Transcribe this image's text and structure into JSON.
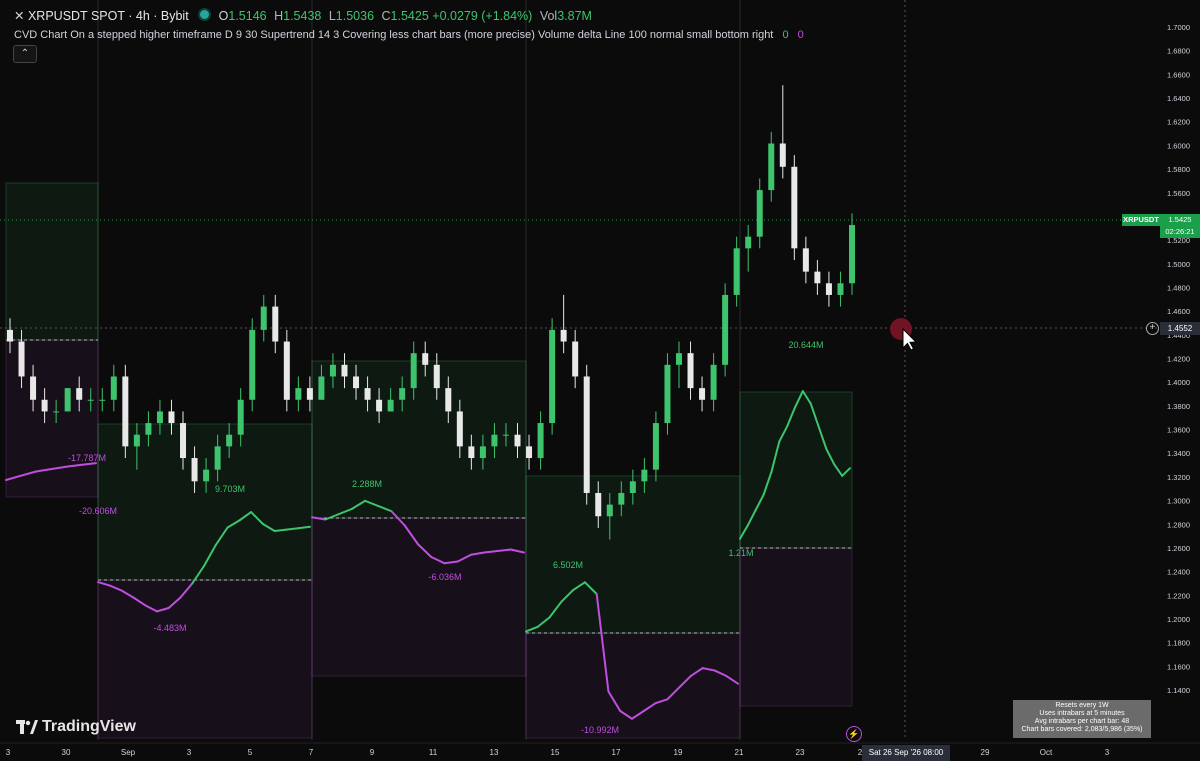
{
  "header": {
    "close_glyph": "✕",
    "symbol": "XRPUSDT SPOT · 4h · Bybit",
    "open_label": "O",
    "open": "1.5146",
    "high_label": "H",
    "high": "1.5438",
    "low_label": "L",
    "low": "1.5036",
    "close_label": "C",
    "close": "1.5425",
    "change": "+0.0279 (+1.84%)",
    "vol_label": "Vol",
    "vol": "3.87M"
  },
  "indicator": {
    "text": "CVD Chart On a stepped higher timeframe D 9 30 Supertrend 14 3 Covering less chart bars (more precise) Volume delta Line 100 normal small bottom right",
    "val1": "0",
    "val2": "0",
    "collapse_glyph": "⌃"
  },
  "price_axis": [
    "1.7000",
    "1.6800",
    "1.6600",
    "1.6400",
    "1.6200",
    "1.6000",
    "1.5800",
    "1.5600",
    "1.5400",
    "1.5200",
    "1.5000",
    "1.4800",
    "1.4600",
    "1.4400",
    "1.4200",
    "1.4000",
    "1.3800",
    "1.3600",
    "1.3400",
    "1.3200",
    "1.3000",
    "1.2800",
    "1.2600",
    "1.2400",
    "1.2200",
    "1.2000",
    "1.1800",
    "1.1600",
    "1.1400"
  ],
  "time_axis": [
    "3",
    "30",
    "Sep",
    "3",
    "5",
    "7",
    "9",
    "11",
    "13",
    "15",
    "17",
    "19",
    "21",
    "23",
    "2",
    "29",
    "Oct",
    "3"
  ],
  "price_tag": {
    "symbol": "XRPUSDT",
    "price": "1.5425",
    "countdown": "02:26:21"
  },
  "crosshair": {
    "price": "1.4552",
    "plus_glyph": "+",
    "time": "Sat 26 Sep '26   08:00"
  },
  "cvd_labels": [
    "-17.787M",
    "-20.606M",
    "9.703M",
    "-4.483M",
    "2.288M",
    "-6.036M",
    "6.502M",
    "-10.992M",
    "20.644M",
    "1.21M"
  ],
  "info_box": [
    "Resets every 1W",
    "Uses intrabars at 5 minutes",
    "Avg intrabars per chart bar: 48",
    "Chart bars covered: 2,083/5,986 (35%)"
  ],
  "branding": {
    "name": "TradingView"
  },
  "colors": {
    "up": "#3ec46d",
    "down": "#e8e8e8",
    "cvd_pos": "#3ec46d",
    "cvd_neg": "#c04ee0",
    "tag": "#1b9f4a"
  },
  "chart_data": {
    "type": "candlestick",
    "symbol": "XRPUSDT",
    "ylim": [
      1.14,
      1.71
    ],
    "candles": [
      [
        1.45,
        1.46,
        1.43,
        1.44
      ],
      [
        1.44,
        1.45,
        1.4,
        1.41
      ],
      [
        1.41,
        1.42,
        1.38,
        1.39
      ],
      [
        1.39,
        1.4,
        1.37,
        1.38
      ],
      [
        1.38,
        1.39,
        1.37,
        1.38
      ],
      [
        1.38,
        1.4,
        1.38,
        1.4
      ],
      [
        1.4,
        1.41,
        1.38,
        1.39
      ],
      [
        1.39,
        1.4,
        1.38,
        1.39
      ],
      [
        1.39,
        1.4,
        1.38,
        1.39
      ],
      [
        1.39,
        1.42,
        1.38,
        1.41
      ],
      [
        1.41,
        1.42,
        1.34,
        1.35
      ],
      [
        1.35,
        1.37,
        1.33,
        1.36
      ],
      [
        1.36,
        1.38,
        1.35,
        1.37
      ],
      [
        1.37,
        1.39,
        1.36,
        1.38
      ],
      [
        1.38,
        1.39,
        1.36,
        1.37
      ],
      [
        1.37,
        1.38,
        1.33,
        1.34
      ],
      [
        1.34,
        1.35,
        1.31,
        1.32
      ],
      [
        1.32,
        1.34,
        1.31,
        1.33
      ],
      [
        1.33,
        1.36,
        1.32,
        1.35
      ],
      [
        1.35,
        1.37,
        1.34,
        1.36
      ],
      [
        1.36,
        1.4,
        1.35,
        1.39
      ],
      [
        1.39,
        1.46,
        1.38,
        1.45
      ],
      [
        1.45,
        1.48,
        1.44,
        1.47
      ],
      [
        1.47,
        1.48,
        1.43,
        1.44
      ],
      [
        1.44,
        1.45,
        1.38,
        1.39
      ],
      [
        1.39,
        1.41,
        1.38,
        1.4
      ],
      [
        1.4,
        1.41,
        1.38,
        1.39
      ],
      [
        1.39,
        1.42,
        1.39,
        1.41
      ],
      [
        1.41,
        1.43,
        1.4,
        1.42
      ],
      [
        1.42,
        1.43,
        1.4,
        1.41
      ],
      [
        1.41,
        1.42,
        1.39,
        1.4
      ],
      [
        1.4,
        1.41,
        1.38,
        1.39
      ],
      [
        1.39,
        1.4,
        1.37,
        1.38
      ],
      [
        1.38,
        1.4,
        1.38,
        1.39
      ],
      [
        1.39,
        1.41,
        1.38,
        1.4
      ],
      [
        1.4,
        1.44,
        1.39,
        1.43
      ],
      [
        1.43,
        1.44,
        1.41,
        1.42
      ],
      [
        1.42,
        1.43,
        1.39,
        1.4
      ],
      [
        1.4,
        1.41,
        1.37,
        1.38
      ],
      [
        1.38,
        1.39,
        1.34,
        1.35
      ],
      [
        1.35,
        1.36,
        1.33,
        1.34
      ],
      [
        1.34,
        1.36,
        1.33,
        1.35
      ],
      [
        1.35,
        1.37,
        1.34,
        1.36
      ],
      [
        1.36,
        1.37,
        1.35,
        1.36
      ],
      [
        1.36,
        1.37,
        1.34,
        1.35
      ],
      [
        1.35,
        1.36,
        1.33,
        1.34
      ],
      [
        1.34,
        1.38,
        1.33,
        1.37
      ],
      [
        1.37,
        1.46,
        1.36,
        1.45
      ],
      [
        1.45,
        1.48,
        1.43,
        1.44
      ],
      [
        1.44,
        1.45,
        1.4,
        1.41
      ],
      [
        1.41,
        1.42,
        1.3,
        1.31
      ],
      [
        1.31,
        1.32,
        1.28,
        1.29
      ],
      [
        1.29,
        1.31,
        1.27,
        1.3
      ],
      [
        1.3,
        1.32,
        1.29,
        1.31
      ],
      [
        1.31,
        1.33,
        1.3,
        1.32
      ],
      [
        1.32,
        1.34,
        1.31,
        1.33
      ],
      [
        1.33,
        1.38,
        1.32,
        1.37
      ],
      [
        1.37,
        1.43,
        1.36,
        1.42
      ],
      [
        1.42,
        1.44,
        1.4,
        1.43
      ],
      [
        1.43,
        1.44,
        1.39,
        1.4
      ],
      [
        1.4,
        1.41,
        1.38,
        1.39
      ],
      [
        1.39,
        1.43,
        1.38,
        1.42
      ],
      [
        1.42,
        1.49,
        1.41,
        1.48
      ],
      [
        1.48,
        1.53,
        1.47,
        1.52
      ],
      [
        1.52,
        1.54,
        1.5,
        1.53
      ],
      [
        1.53,
        1.58,
        1.52,
        1.57
      ],
      [
        1.57,
        1.62,
        1.56,
        1.61
      ],
      [
        1.61,
        1.66,
        1.58,
        1.59
      ],
      [
        1.59,
        1.6,
        1.51,
        1.52
      ],
      [
        1.52,
        1.53,
        1.49,
        1.5
      ],
      [
        1.5,
        1.51,
        1.48,
        1.49
      ],
      [
        1.49,
        1.5,
        1.47,
        1.48
      ],
      [
        1.48,
        1.5,
        1.47,
        1.49
      ],
      [
        1.49,
        1.55,
        1.48,
        1.54
      ]
    ],
    "cvd_series": [
      {
        "name": "Volume delta",
        "segment": 1,
        "values": [
          -17.787,
          -18.5,
          -19.2,
          -19.6,
          -20.0,
          -20.3,
          -20.606
        ]
      },
      {
        "name": "Volume delta",
        "segment": 2,
        "values": [
          -0.3,
          -0.8,
          -1.5,
          -2.5,
          -3.6,
          -4.483,
          -4.0,
          -2.5,
          -0.5,
          2.0,
          5.0,
          7.5,
          8.5,
          9.703,
          8.0,
          7.0,
          7.2,
          7.4,
          7.6
        ]
      },
      {
        "name": "Volume delta",
        "segment": 3,
        "values": [
          0.1,
          -0.2,
          0.5,
          1.2,
          2.288,
          1.6,
          0.9,
          -1.0,
          -3.5,
          -5.2,
          -6.036,
          -5.8,
          -4.9,
          -4.6,
          -4.4,
          -4.2,
          -4.6
        ]
      },
      {
        "name": "Volume delta",
        "segment": 4,
        "values": [
          0.2,
          0.8,
          2.0,
          4.0,
          5.5,
          6.502,
          5.0,
          -7.5,
          -10.0,
          -10.992,
          -10.0,
          -9.0,
          -8.5,
          -7.0,
          -5.5,
          -4.5,
          -4.8,
          -5.5,
          -6.5
        ]
      },
      {
        "name": "Volume delta",
        "segment": 5,
        "values": [
          1.21,
          3.0,
          5.0,
          7.0,
          10.0,
          14.0,
          16.0,
          18.5,
          20.644,
          19.0,
          16.0,
          13.0,
          11.0,
          9.5,
          10.5
        ]
      }
    ]
  }
}
